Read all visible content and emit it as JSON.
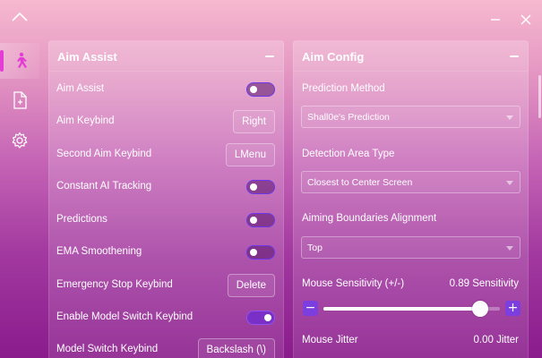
{
  "window": {
    "collapse_icon": "chevron-up-icon",
    "minimize_icon": "minimize-icon",
    "close_icon": "close-icon"
  },
  "sidebar": {
    "items": [
      {
        "name": "aim",
        "icon": "running-person-icon",
        "active": true
      },
      {
        "name": "config",
        "icon": "document-icon",
        "active": false
      },
      {
        "name": "settings",
        "icon": "gear-icon",
        "active": false
      }
    ],
    "accent": "#e43dd6"
  },
  "aim_assist": {
    "title": "Aim Assist",
    "rows": [
      {
        "label": "Aim Assist",
        "control": "toggle",
        "on": false
      },
      {
        "label": "Aim Keybind",
        "control": "key",
        "value": "Right"
      },
      {
        "label": "Second Aim Keybind",
        "control": "key",
        "value": "LMenu"
      },
      {
        "label": "Constant AI Tracking",
        "control": "toggle",
        "on": false
      },
      {
        "label": "Predictions",
        "control": "toggle",
        "on": false
      },
      {
        "label": "EMA Smoothening",
        "control": "toggle",
        "on": false
      },
      {
        "label": "Emergency Stop Keybind",
        "control": "key",
        "value": "Delete"
      },
      {
        "label": "Enable Model Switch Keybind",
        "control": "toggle",
        "on": true
      },
      {
        "label": "Model Switch Keybind",
        "control": "key",
        "value": "Backslash (\\)"
      }
    ]
  },
  "aim_config": {
    "title": "Aim Config",
    "prediction_method": {
      "label": "Prediction Method",
      "value": "Shall0e's Prediction"
    },
    "detection_area": {
      "label": "Detection Area Type",
      "value": "Closest to Center Screen"
    },
    "boundaries": {
      "label": "Aiming Boundaries Alignment",
      "value": "Top"
    },
    "mouse_sensitivity": {
      "label": "Mouse Sensitivity (+/-)",
      "value_text": "0.89 Sensitivity",
      "value": 0.89,
      "min": 0,
      "max": 1,
      "minus": "−",
      "plus": "+"
    },
    "mouse_jitter": {
      "label": "Mouse Jitter",
      "value_text": "0.00 Jitter"
    }
  },
  "colors": {
    "accent": "#7d3ee0",
    "toggle_border": "#6a38e8"
  }
}
